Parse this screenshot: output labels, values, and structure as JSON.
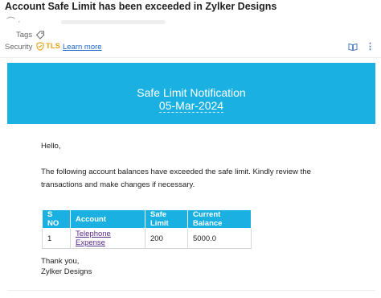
{
  "email": {
    "subject": "Account Safe Limit has been exceeded in Zylker Designs",
    "tags_label": "Tags",
    "security_label": "Security",
    "security_protocol": "TLS",
    "learn_more": "Learn more"
  },
  "banner": {
    "title": "Safe Limit Notification",
    "date": "05-Mar-2024",
    "color": "#1ab1e2"
  },
  "body": {
    "greeting": "Hello,",
    "paragraph": "The following account balances have exceeded the safe limit. Kindly review the transactions and make changes if necessary.",
    "sign_off_line1": "Thank you,",
    "sign_off_line2": "Zylker Designs"
  },
  "table": {
    "headers": [
      "S NO",
      "Account",
      "Safe Limit",
      "Current Balance"
    ],
    "rows": [
      [
        "1",
        "Telephone Expense",
        "200",
        "5000.0"
      ]
    ]
  },
  "icons": {
    "tag": "tag-icon",
    "tls": "shield-icon",
    "book": "book-icon",
    "more": "more-icon"
  }
}
